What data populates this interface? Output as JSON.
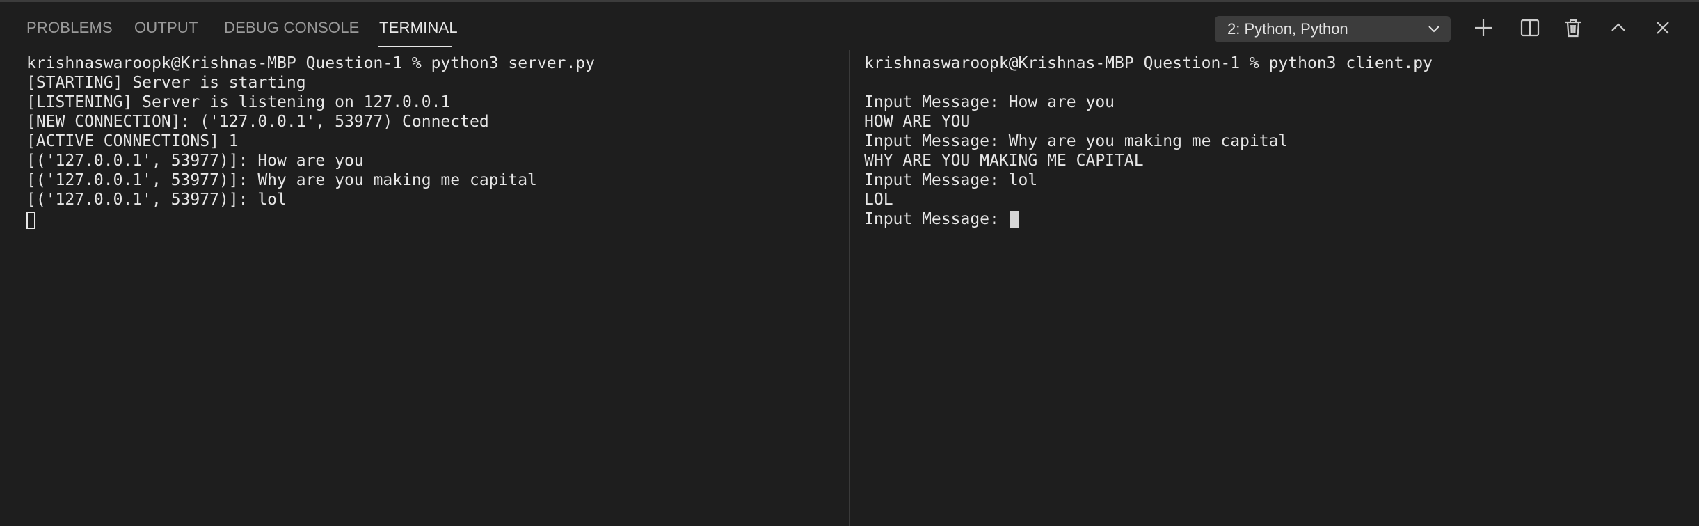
{
  "panel": {
    "tabs": [
      {
        "label": "PROBLEMS",
        "active": false
      },
      {
        "label": "OUTPUT",
        "active": false
      },
      {
        "label": "DEBUG CONSOLE",
        "active": false
      },
      {
        "label": "TERMINAL",
        "active": true
      }
    ],
    "terminal_selector": {
      "selected": "2: Python, Python"
    },
    "actions": [
      {
        "name": "new-terminal",
        "icon": "plus-icon"
      },
      {
        "name": "split-terminal",
        "icon": "split-icon"
      },
      {
        "name": "kill-terminal",
        "icon": "trash-icon"
      },
      {
        "name": "maximize-panel",
        "icon": "chevron-up-icon"
      },
      {
        "name": "close-panel",
        "icon": "close-icon"
      }
    ]
  },
  "terminals": {
    "left": {
      "lines": [
        "krishnaswaroopk@Krishnas-MBP Question-1 % python3 server.py",
        "[STARTING] Server is starting",
        "[LISTENING] Server is listening on 127.0.0.1",
        "[NEW CONNECTION]: ('127.0.0.1', 53977) Connected",
        "[ACTIVE CONNECTIONS] 1",
        "[('127.0.0.1', 53977)]: How are you",
        "[('127.0.0.1', 53977)]: Why are you making me capital",
        "[('127.0.0.1', 53977)]: lol"
      ]
    },
    "right": {
      "lines": [
        "krishnaswaroopk@Krishnas-MBP Question-1 % python3 client.py",
        "",
        "Input Message: How are you",
        "HOW ARE YOU",
        "Input Message: Why are you making me capital",
        "WHY ARE YOU MAKING ME CAPITAL",
        "Input Message: lol",
        "LOL",
        "Input Message: "
      ]
    }
  },
  "colors": {
    "background": "#1e1e1e",
    "text": "#e6e6e6",
    "tab_inactive": "#9a9a9a",
    "tab_active": "#e7e7e7",
    "select_bg": "#3c3c3c"
  }
}
